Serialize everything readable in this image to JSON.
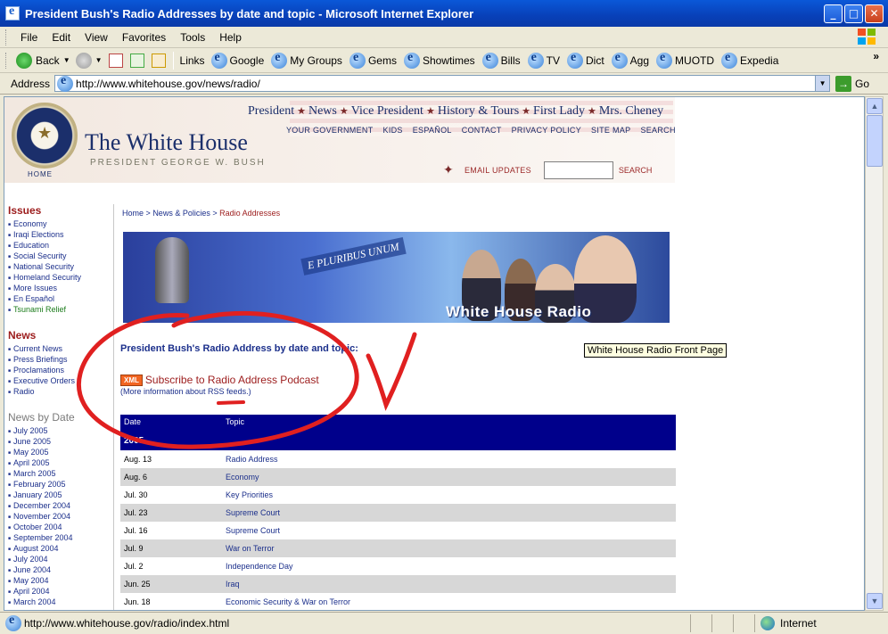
{
  "window": {
    "title": "President Bush's Radio Addresses by date and topic - Microsoft Internet Explorer",
    "min": "_",
    "max": "□",
    "close": "✕"
  },
  "menu": [
    "File",
    "Edit",
    "View",
    "Favorites",
    "Tools",
    "Help"
  ],
  "toolbar": {
    "back": "Back",
    "links_label": "Links",
    "links": [
      "Google",
      "My Groups",
      "Gems",
      "Showtimes",
      "Bills",
      "TV",
      "Dict",
      "Agg",
      "MUOTD",
      "Expedia"
    ],
    "overflow": "»"
  },
  "address": {
    "label": "Address",
    "url": "http://www.whitehouse.gov/news/radio/",
    "go": "Go"
  },
  "header": {
    "site_title": "The White House",
    "subtitle": "PRESIDENT GEORGE W. BUSH",
    "home": "HOME",
    "topnav": [
      "President",
      "News",
      "Vice President",
      "History & Tours",
      "First Lady",
      "Mrs. Cheney"
    ],
    "subnav": [
      "YOUR GOVERNMENT",
      "KIDS",
      "ESPAÑOL",
      "CONTACT",
      "PRIVACY POLICY",
      "SITE MAP",
      "SEARCH"
    ],
    "email_updates": "EMAIL UPDATES",
    "search": "SEARCH"
  },
  "leftnav": {
    "issues_title": "Issues",
    "issues": [
      "Economy",
      "Iraqi Elections",
      "Education",
      "Social Security",
      "National Security",
      "Homeland Security",
      "More Issues",
      "En Español",
      "Tsunami Relief"
    ],
    "news_title": "News",
    "news": [
      "Current News",
      "Press Briefings",
      "Proclamations",
      "Executive Orders",
      "Radio"
    ],
    "bydate_title": "News by Date",
    "bydate": [
      "July 2005",
      "June 2005",
      "May 2005",
      "April 2005",
      "March 2005",
      "February 2005",
      "January 2005",
      "December 2004",
      "November 2004",
      "October 2004",
      "September 2004",
      "August 2004",
      "July 2004",
      "June 2004",
      "May 2004",
      "April 2004",
      "March 2004"
    ]
  },
  "breadcrumb": {
    "home": "Home",
    "sep": ">",
    "news": "News & Policies",
    "current": "Radio Addresses"
  },
  "banner": {
    "motto": "E PLURIBUS UNUM",
    "title": "White House Radio"
  },
  "tooltip": "White House Radio Front Page",
  "page_heading": "President Bush's Radio Address by date and topic:",
  "podcast": {
    "badge": "XML",
    "link": "Subscribe to Radio Address Podcast",
    "note_prefix": "(More information about ",
    "note_link": "RSS feeds",
    "note_suffix": ".)"
  },
  "table": {
    "col_date": "Date",
    "col_topic": "Topic",
    "year": "2005",
    "rows": [
      {
        "date": "Aug. 13",
        "topic": "Radio Address"
      },
      {
        "date": "Aug. 6",
        "topic": "Economy"
      },
      {
        "date": "Jul. 30",
        "topic": "Key Priorities"
      },
      {
        "date": "Jul. 23",
        "topic": "Supreme Court"
      },
      {
        "date": "Jul. 16",
        "topic": "Supreme Court"
      },
      {
        "date": "Jul. 9",
        "topic": "War on Terror"
      },
      {
        "date": "Jul. 2",
        "topic": "Independence Day"
      },
      {
        "date": "Jun. 25",
        "topic": "Iraq"
      },
      {
        "date": "Jun. 18",
        "topic": "Economic Security & War on Terror"
      }
    ]
  },
  "status": {
    "text": "http://www.whitehouse.gov/radio/index.html",
    "zone": "Internet"
  },
  "colors": {
    "title_bar": "#0840b8",
    "navy": "#1b2f6b",
    "link_blue": "#1b2f8b",
    "red": "#9c1c1c",
    "table_header": "#00008b",
    "annotation": "#e02020"
  }
}
